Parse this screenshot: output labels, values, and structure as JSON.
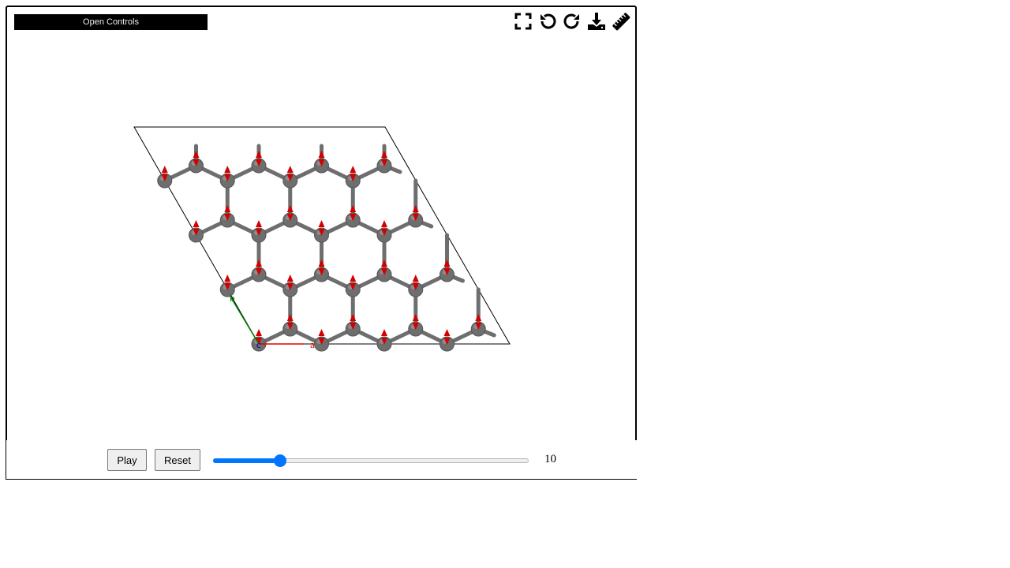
{
  "viewer": {
    "open_controls_label": "Open Controls",
    "toolbar": [
      {
        "name": "fullscreen-icon"
      },
      {
        "name": "undo-icon"
      },
      {
        "name": "redo-icon"
      },
      {
        "name": "download-icon"
      },
      {
        "name": "ruler-icon"
      }
    ],
    "axes": {
      "a": "a",
      "b": "b",
      "c": "c"
    },
    "colors": {
      "atom": "#6e6e6e",
      "arrow": "#d40000",
      "axis_a": "#e00000",
      "axis_b": "#008000",
      "axis_c": "#0000cc"
    }
  },
  "playback": {
    "play_label": "Play",
    "reset_label": "Reset",
    "frame_value": "10",
    "slider_fraction": 0.2
  }
}
